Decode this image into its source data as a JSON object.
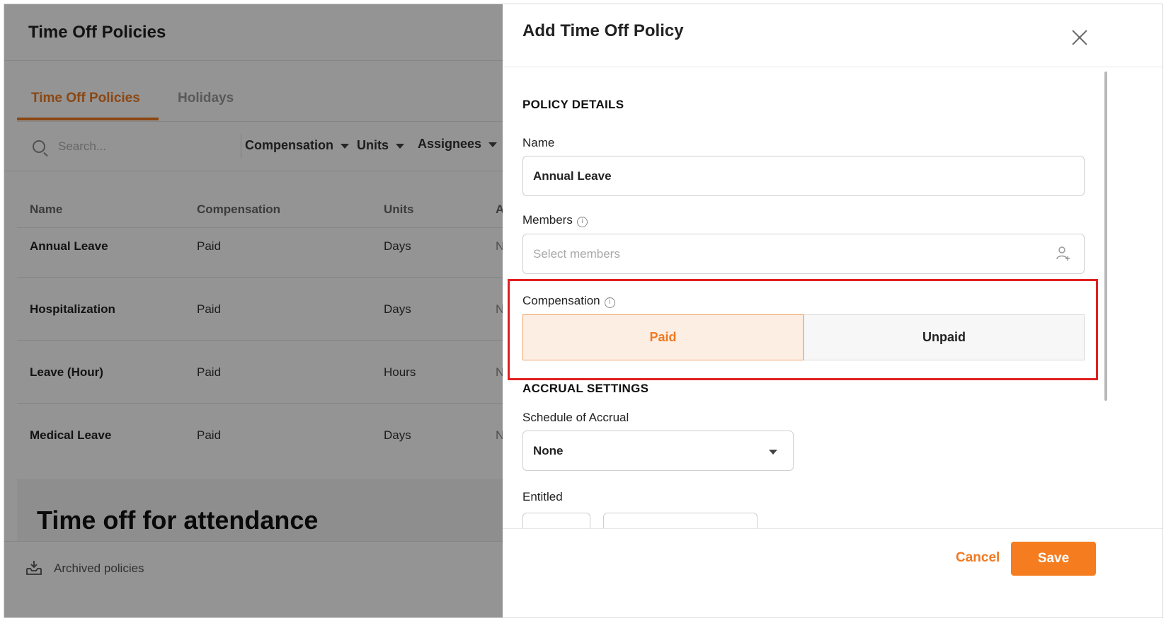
{
  "page": {
    "title": "Time Off Policies"
  },
  "tabs": [
    {
      "label": "Time Off Policies",
      "active": true
    },
    {
      "label": "Holidays",
      "active": false
    }
  ],
  "filters": {
    "search_placeholder": "Search...",
    "items": [
      "Compensation",
      "Units",
      "Assignees"
    ]
  },
  "table": {
    "headers": [
      "Name",
      "Compensation",
      "Units",
      "A"
    ],
    "rows": [
      {
        "name": "Annual Leave",
        "compensation": "Paid",
        "units": "Days",
        "extra": "N"
      },
      {
        "name": "Hospitalization",
        "compensation": "Paid",
        "units": "Days",
        "extra": "N"
      },
      {
        "name": "Leave (Hour)",
        "compensation": "Paid",
        "units": "Hours",
        "extra": "N"
      },
      {
        "name": "Medical Leave",
        "compensation": "Paid",
        "units": "Days",
        "extra": "N"
      }
    ]
  },
  "attendance": {
    "title": "Time off for attendance"
  },
  "left_footer": {
    "archived_label": "Archived policies"
  },
  "drawer": {
    "title": "Add Time Off Policy",
    "policy_details": {
      "heading": "POLICY DETAILS",
      "name_label": "Name",
      "name_value": "Annual Leave",
      "members_label": "Members",
      "members_placeholder": "Select members",
      "compensation_label": "Compensation",
      "compensation_options": [
        "Paid",
        "Unpaid"
      ],
      "compensation_selected": "Paid"
    },
    "accrual_settings": {
      "heading": "ACCRUAL SETTINGS",
      "schedule_label": "Schedule of Accrual",
      "schedule_value": "None",
      "entitled_label": "Entitled"
    },
    "footer": {
      "cancel_label": "Cancel",
      "save_label": "Save"
    }
  },
  "colors": {
    "accent": "#f07a22",
    "save_button": "#f57c1f",
    "selected_segment_bg": "#fdeee3",
    "highlight_border": "#e02020",
    "overlay": "rgba(0,0,0,0.42)"
  },
  "icons": [
    "search-icon",
    "chevron-down-icon",
    "info-icon",
    "add-person-icon",
    "close-icon",
    "archive-icon"
  ]
}
